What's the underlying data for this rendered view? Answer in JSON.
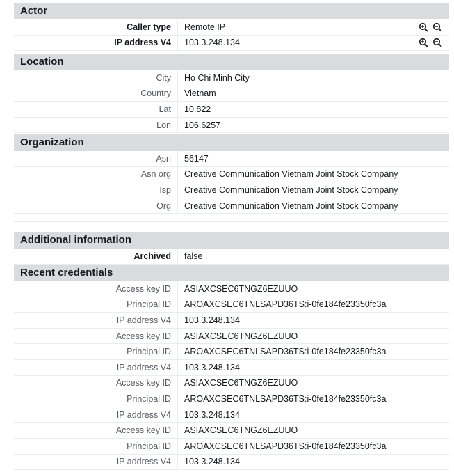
{
  "actor": {
    "title": "Actor",
    "rows": [
      {
        "key": "Caller type",
        "value": "Remote IP"
      },
      {
        "key": "IP address V4",
        "value": "103.3.248.134"
      }
    ]
  },
  "location": {
    "title": "Location",
    "rows": [
      {
        "key": "City",
        "value": "Ho Chi Minh City"
      },
      {
        "key": "Country",
        "value": "Vietnam"
      },
      {
        "key": "Lat",
        "value": "10.822"
      },
      {
        "key": "Lon",
        "value": "106.6257"
      }
    ]
  },
  "organization": {
    "title": "Organization",
    "rows": [
      {
        "key": "Asn",
        "value": "56147"
      },
      {
        "key": "Asn org",
        "value": "Creative Communication Vietnam Joint Stock Company"
      },
      {
        "key": "Isp",
        "value": "Creative Communication Vietnam Joint Stock Company"
      },
      {
        "key": "Org",
        "value": "Creative Communication Vietnam Joint Stock Company"
      }
    ]
  },
  "additional": {
    "title": "Additional information",
    "rows": [
      {
        "key": "Archived",
        "value": "false"
      }
    ]
  },
  "credentials": {
    "title": "Recent credentials",
    "rows": [
      {
        "key": "Access key ID",
        "value": "ASIAXCSEC6TNGZ6EZUUO"
      },
      {
        "key": "Principal ID",
        "value": "AROAXCSEC6TNLSAPD36TS:i-0fe184fe23350fc3a"
      },
      {
        "key": "IP address V4",
        "value": "103.3.248.134"
      },
      {
        "key": "Access key ID",
        "value": "ASIAXCSEC6TNGZ6EZUUO"
      },
      {
        "key": "Principal ID",
        "value": "AROAXCSEC6TNLSAPD36TS:i-0fe184fe23350fc3a"
      },
      {
        "key": "IP address V4",
        "value": "103.3.248.134"
      },
      {
        "key": "Access key ID",
        "value": "ASIAXCSEC6TNGZ6EZUUO"
      },
      {
        "key": "Principal ID",
        "value": "AROAXCSEC6TNLSAPD36TS:i-0fe184fe23350fc3a"
      },
      {
        "key": "IP address V4",
        "value": "103.3.248.134"
      },
      {
        "key": "Access key ID",
        "value": "ASIAXCSEC6TNGZ6EZUUO"
      },
      {
        "key": "Principal ID",
        "value": "AROAXCSEC6TNLSAPD36TS:i-0fe184fe23350fc3a"
      },
      {
        "key": "IP address V4",
        "value": "103.3.248.134"
      }
    ]
  },
  "icons": {
    "filter_in": "zoom-in-icon",
    "filter_out": "zoom-out-icon"
  }
}
